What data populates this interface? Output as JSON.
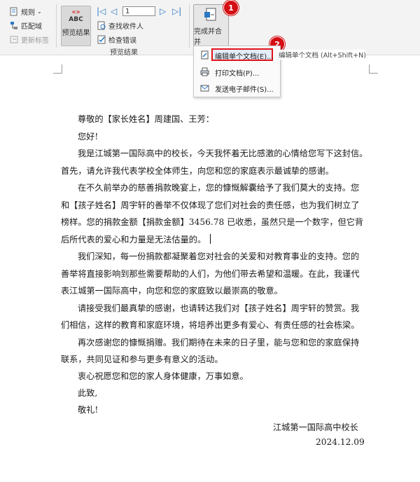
{
  "ribbon": {
    "rules_label": "规则",
    "match_fields_label": "匹配域",
    "update_labels_label": "更新标签",
    "preview_results_label": "预览结果",
    "preview_abc": "ABC",
    "preview_arrows": "«»",
    "record_number": "1",
    "find_recipient_label": "查找收件人",
    "check_errors_label": "检查错误",
    "group_preview_label": "预览结果",
    "finish_merge_label": "完成并合并"
  },
  "menu": {
    "items": [
      {
        "label": "编辑单个文档(E)..."
      },
      {
        "label": "打印文档(P)..."
      },
      {
        "label": "发送电子邮件(S)..."
      }
    ]
  },
  "tooltip": "编辑单个文档 (Alt+Shift+N)",
  "callouts": [
    "1",
    "2"
  ],
  "document": {
    "lines": [
      "尊敬的【家长姓名】周建国、王芳：",
      "您好!",
      "我是江城第一国际高中的校长，今天我怀着无比感激的心情给您写下这封信。",
      "首先，请允许我代表学校全体师生，向您和您的家庭表示最诚挚的感谢。",
      "在不久前举办的慈善捐款晚宴上，您的慷慨解囊给予了我们莫大的支持。您",
      "和【孩子姓名】周宇轩的善举不仅体现了您们对社会的责任感，也为我们树立了",
      "榜样。您的捐款金额【捐款金额】3456.78 已收悉，虽然只是一个数字，但它背",
      "后所代表的爱心和力量是无法估量的。",
      "我们深知，每一份捐款都凝聚着您对社会的关爱和对教育事业的支持。您的",
      "善举将直接影响到那些需要帮助的人们，为他们带去希望和温暖。在此，我谨代",
      "表江城第一国际高中，向您和您的家庭致以最崇高的敬意。",
      "请接受我们最真挚的感谢，也请转达我们对【孩子姓名】周宇轩的赞赏。我",
      "们相信，这样的教育和家庭环境，将培养出更多有爱心、有责任感的社会栋梁。",
      "再次感谢您的慷慨捐赠。我们期待在未来的日子里，能与您和您的家庭保持",
      "联系，共同见证和参与更多有意义的活动。",
      "衷心祝愿您和您的家人身体健康，万事如意。",
      "此致,",
      "敬礼!",
      "江城第一国际高中校长",
      "2024.12.09"
    ]
  }
}
